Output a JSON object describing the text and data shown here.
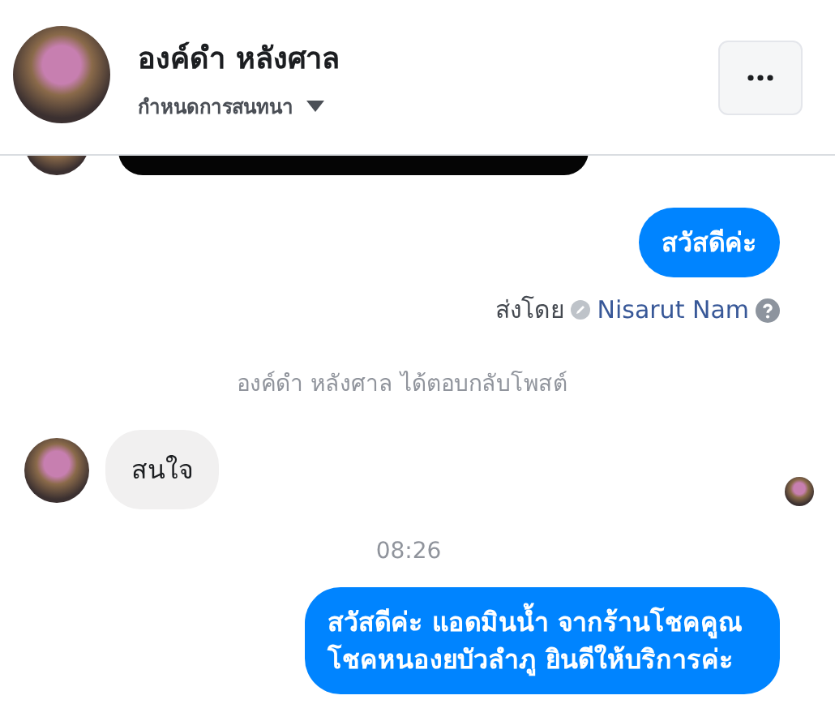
{
  "header": {
    "name": "องค์ดำ หลังศาล",
    "subtitle": "กำหนดการสนทนา"
  },
  "messages": [
    {
      "kind": "media"
    },
    {
      "kind": "outgoing",
      "text": "สวัสดีค่ะ"
    },
    {
      "kind": "sent_by",
      "label": "ส่งโดย",
      "sender": "Nisarut Nam"
    },
    {
      "kind": "system",
      "text": "องค์ดำ หลังศาล ได้ตอบกลับโพสต์"
    },
    {
      "kind": "incoming",
      "text": "สนใจ",
      "seen": true
    },
    {
      "kind": "time",
      "text": "08:26"
    },
    {
      "kind": "outgoing",
      "text": "สวัสดีค่ะ แอดมินน้ำ จากร้านโชคคูณ โชคหนองยบัวลำภู ยินดีให้บริการค่ะ"
    }
  ]
}
